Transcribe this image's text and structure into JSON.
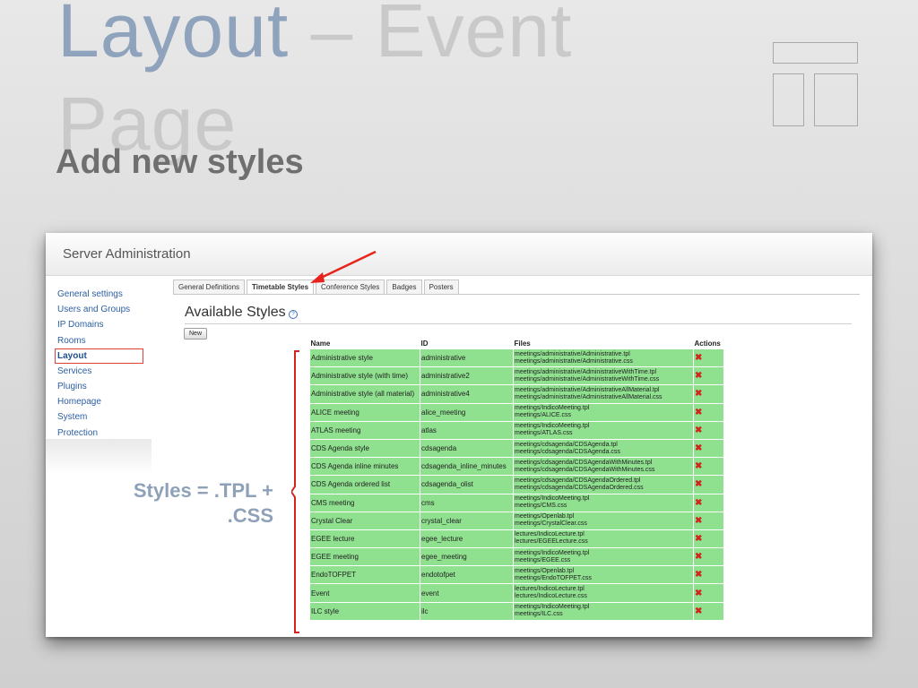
{
  "slide": {
    "title_part1": "Layout",
    "title_part2": " – Event Page",
    "subtitle": "Add new styles"
  },
  "app": {
    "title": "Server Administration"
  },
  "sidebar": {
    "items": [
      {
        "label": "General settings",
        "active": false
      },
      {
        "label": "Users and Groups",
        "active": false
      },
      {
        "label": "IP Domains",
        "active": false
      },
      {
        "label": "Rooms",
        "active": false
      },
      {
        "label": "Layout",
        "active": true
      },
      {
        "label": "Services",
        "active": false
      },
      {
        "label": "Plugins",
        "active": false
      },
      {
        "label": "Homepage",
        "active": false
      },
      {
        "label": "System",
        "active": false
      },
      {
        "label": "Protection",
        "active": false
      }
    ]
  },
  "tabs": [
    {
      "label": "General Definitions",
      "active": false
    },
    {
      "label": "Timetable Styles",
      "active": true
    },
    {
      "label": "Conference Styles",
      "active": false
    },
    {
      "label": "Badges",
      "active": false
    },
    {
      "label": "Posters",
      "active": false
    }
  ],
  "main": {
    "section_title": "Available Styles",
    "help_icon": "?",
    "new_button": "New"
  },
  "table": {
    "headers": [
      "Name",
      "ID",
      "Files",
      "Actions"
    ],
    "rows": [
      {
        "name": "Administrative style",
        "id": "administrative",
        "file1": "meetings/administrative/Administrative.tpl",
        "file2": "meetings/administrative/Administrative.css"
      },
      {
        "name": "Administrative style (with time)",
        "id": "administrative2",
        "file1": "meetings/administrative/AdministrativeWithTime.tpl",
        "file2": "meetings/administrative/AdministrativeWithTime.css"
      },
      {
        "name": "Administrative style (all material)",
        "id": "administrative4",
        "file1": "meetings/administrative/AdministrativeAllMaterial.tpl",
        "file2": "meetings/administrative/AdministrativeAllMaterial.css"
      },
      {
        "name": "ALICE meeting",
        "id": "alice_meeting",
        "file1": "meetings/IndicoMeeting.tpl",
        "file2": "meetings/ALICE.css"
      },
      {
        "name": "ATLAS meeting",
        "id": "atlas",
        "file1": "meetings/IndicoMeeting.tpl",
        "file2": "meetings/ATLAS.css"
      },
      {
        "name": "CDS Agenda style",
        "id": "cdsagenda",
        "file1": "meetings/cdsagenda/CDSAgenda.tpl",
        "file2": "meetings/cdsagenda/CDSAgenda.css"
      },
      {
        "name": "CDS Agenda inline minutes",
        "id": "cdsagenda_inline_minutes",
        "file1": "meetings/cdsagenda/CDSAgendaWithMinutes.tpl",
        "file2": "meetings/cdsagenda/CDSAgendaWithMinutes.css"
      },
      {
        "name": "CDS Agenda ordered list",
        "id": "cdsagenda_olist",
        "file1": "meetings/cdsagenda/CDSAgendaOrdered.tpl",
        "file2": "meetings/cdsagenda/CDSAgendaOrdered.css"
      },
      {
        "name": "CMS meeting",
        "id": "cms",
        "file1": "meetings/IndicoMeeting.tpl",
        "file2": "meetings/CMS.css"
      },
      {
        "name": "Crystal Clear",
        "id": "crystal_clear",
        "file1": "meetings/Openlab.tpl",
        "file2": "meetings/CrystalClear.css"
      },
      {
        "name": "EGEE lecture",
        "id": "egee_lecture",
        "file1": "lectures/IndicoLecture.tpl",
        "file2": "lectures/EGEELecture.css"
      },
      {
        "name": "EGEE meeting",
        "id": "egee_meeting",
        "file1": "meetings/IndicoMeeting.tpl",
        "file2": "meetings/EGEE.css"
      },
      {
        "name": "EndoTOFPET",
        "id": "endotofpet",
        "file1": "meetings/Openlab.tpl",
        "file2": "meetings/EndoTOFPET.css"
      },
      {
        "name": "Event",
        "id": "event",
        "file1": "lectures/IndicoLecture.tpl",
        "file2": "lectures/IndicoLecture.css"
      },
      {
        "name": "ILC style",
        "id": "ilc",
        "file1": "meetings/IndicoMeeting.tpl",
        "file2": "meetings/ILC.css"
      }
    ]
  },
  "annotation": {
    "line1": "Styles = .TPL +",
    "line2": ".CSS"
  },
  "icons": {
    "delete": "✖"
  },
  "colors": {
    "row_green": "#8fe08f",
    "delete_red": "#d2231c",
    "link_blue": "#2c5fa3",
    "highlight_red": "#e0403c",
    "title_blue": "#8fa3bd"
  }
}
